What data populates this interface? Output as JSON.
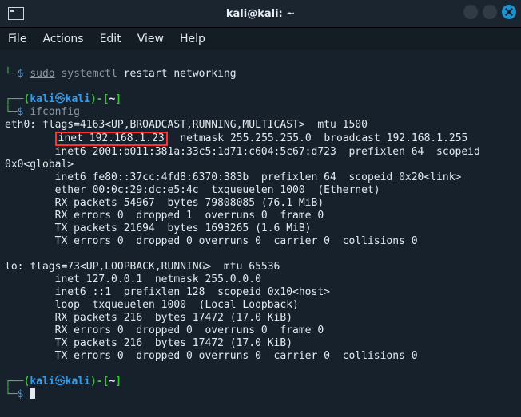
{
  "titlebar": {
    "title": "kali@kali: ~"
  },
  "menu": {
    "file": "File",
    "actions": "Actions",
    "edit": "Edit",
    "view": "View",
    "help": "Help"
  },
  "p1": {
    "elbow": "└─",
    "dollar": "$ ",
    "sudo": "sudo",
    "systemctl": " systemctl",
    "rest": " restart networking"
  },
  "p2": {
    "top_open": "┌──(",
    "user": "kali",
    "at": "㉿",
    "host": "kali",
    "top_close": ")-[",
    "cwd": "~",
    "top_end": "]",
    "elbow": "└─",
    "dollar": "$ ",
    "cmd": "ifconfig"
  },
  "if": {
    "l0": "eth0: flags=4163<UP,BROADCAST,RUNNING,MULTICAST>  mtu 1500",
    "l1a": "        ",
    "l1b": "inet 192.168.1.23",
    "l1c": "  netmask 255.255.255.0  broadcast 192.168.1.255",
    "l2": "        inet6 2001:b011:381a:33c5:1d71:c604:5c67:d723  prefixlen 64  scopeid",
    "l2b": "0x0<global>",
    "l3": "        inet6 fe80::37cc:4fd8:6370:383b  prefixlen 64  scopeid 0x20<link>",
    "l4": "        ether 00:0c:29:dc:e5:4c  txqueuelen 1000  (Ethernet)",
    "l5": "        RX packets 54967  bytes 79808085 (76.1 MiB)",
    "l6": "        RX errors 0  dropped 1  overruns 0  frame 0",
    "l7": "        TX packets 21694  bytes 1693265 (1.6 MiB)",
    "l8": "        TX errors 0  dropped 0 overruns 0  carrier 0  collisions 0",
    "l9": "",
    "l10": "lo: flags=73<UP,LOOPBACK,RUNNING>  mtu 65536",
    "l11": "        inet 127.0.0.1  netmask 255.0.0.0",
    "l12": "        inet6 ::1  prefixlen 128  scopeid 0x10<host>",
    "l13": "        loop  txqueuelen 1000  (Local Loopback)",
    "l14": "        RX packets 216  bytes 17472 (17.0 KiB)",
    "l15": "        RX errors 0  dropped 0  overruns 0  frame 0",
    "l16": "        TX packets 216  bytes 17472 (17.0 KiB)",
    "l17": "        TX errors 0  dropped 0 overruns 0  carrier 0  collisions 0"
  },
  "p3": {
    "top_open": "┌──(",
    "user": "kali",
    "at": "㉿",
    "host": "kali",
    "top_close": ")-[",
    "cwd": "~",
    "top_end": "]",
    "elbow": "└─",
    "dollar": "$ "
  }
}
